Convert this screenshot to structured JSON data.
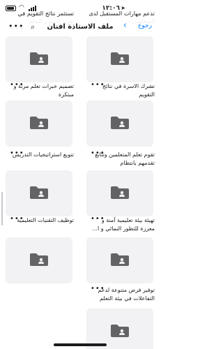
{
  "status_bar": {
    "time": "١٢:٠٦"
  },
  "header": {
    "back_label": "رجوع",
    "title": "ملف الاستاذة افنان",
    "search_icon": "search-icon",
    "more_icon": "more-icon",
    "bg_labels": [
      "تدعم مهارات المستقبل لدى المتعلمين",
      "تستثمر نتائج التقويم في تعزيز النمو و التعلم"
    ]
  },
  "cards": [
    {
      "label": "",
      "icon": "folder-icon"
    },
    {
      "label": "",
      "icon": "folder-icon"
    },
    {
      "label": "تشرك الاسرة في نتائج التقويم",
      "icon": "folder-icon"
    },
    {
      "label": "تصميم خبرات تعلم مرنة و مبتكرة",
      "icon": "folder-icon"
    },
    {
      "label": "تقوم تعلم المتعلمين وتتابع تقدمهم بانتظام",
      "icon": "folder-icon"
    },
    {
      "label": "تنويع استراتيجيات التدريس",
      "icon": "folder-icon"
    },
    {
      "label": "تهيئة بيئة تعليمية آمنة و معززة للتطور النمائي و ا...",
      "icon": "folder-icon"
    },
    {
      "label": "توظيف التقنيات التعليمية",
      "icon": "folder-icon"
    },
    {
      "label": "توفير فرص متنوعة لدعم التفاعلات في بيئة التعلم",
      "icon": "folder-icon"
    }
  ],
  "colors": {
    "accent": "#0a84ff",
    "thumb_bg": "#f2f2f4",
    "folder": "#636366"
  }
}
